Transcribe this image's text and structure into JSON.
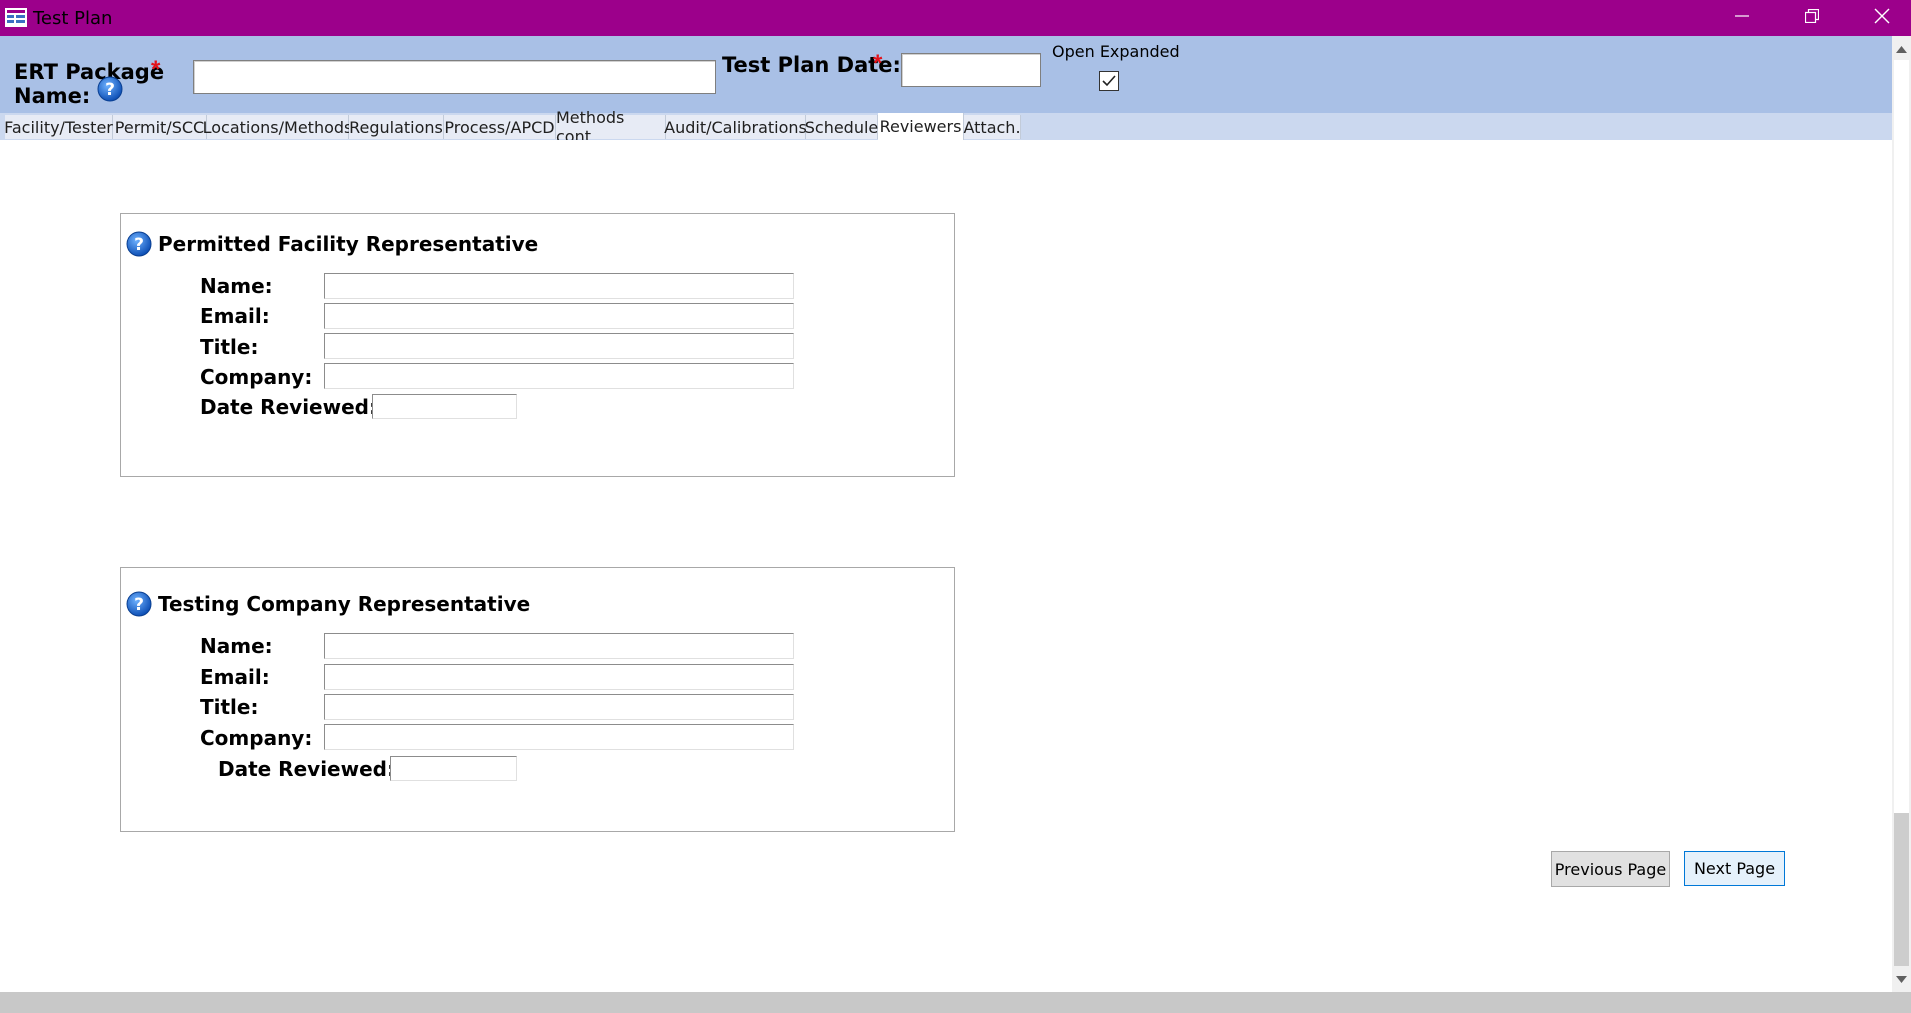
{
  "window": {
    "title": "Test Plan",
    "icons": {
      "app": "form-icon",
      "minimize": "minimize-icon",
      "restore": "restore-icon",
      "close": "close-icon"
    }
  },
  "header": {
    "package_label_line1": "ERT Package",
    "package_label_line2": "Name:",
    "required_mark": "*",
    "package_value": "",
    "date_label": "Test Plan Date:",
    "date_value": "",
    "open_expanded_label": "Open Expanded",
    "open_expanded_checked": true
  },
  "tabs": [
    {
      "label": "Facility/Tester"
    },
    {
      "label": "Permit/SCC"
    },
    {
      "label": "Locations/Methods"
    },
    {
      "label": "Regulations"
    },
    {
      "label": "Process/APCD"
    },
    {
      "label": "Methods cont."
    },
    {
      "label": "Audit/Calibrations"
    },
    {
      "label": "Schedule"
    },
    {
      "label": "Reviewers",
      "active": true
    },
    {
      "label": "Attach."
    }
  ],
  "facility_rep": {
    "title": "Permitted Facility Representative",
    "name_label": "Name:",
    "email_label": "Email:",
    "title_label": "Title:",
    "company_label": "Company:",
    "date_label": "Date Reviewed:",
    "name_value": "",
    "email_value": "",
    "title_value": "",
    "company_value": "",
    "date_value": ""
  },
  "testing_rep": {
    "title": "Testing Company Representative",
    "name_label": "Name:",
    "email_label": "Email:",
    "title_label": "Title:",
    "company_label": "Company:",
    "date_label": "Date Reviewed:",
    "name_value": "",
    "email_value": "",
    "title_value": "",
    "company_value": "",
    "date_value": ""
  },
  "nav": {
    "previous_label": "Previous Page",
    "next_label": "Next Page"
  },
  "colors": {
    "titlebar": "#9c008b",
    "header": "#a9c0e6",
    "required": "#e3131b",
    "help_icon": "#0f5fc7"
  }
}
